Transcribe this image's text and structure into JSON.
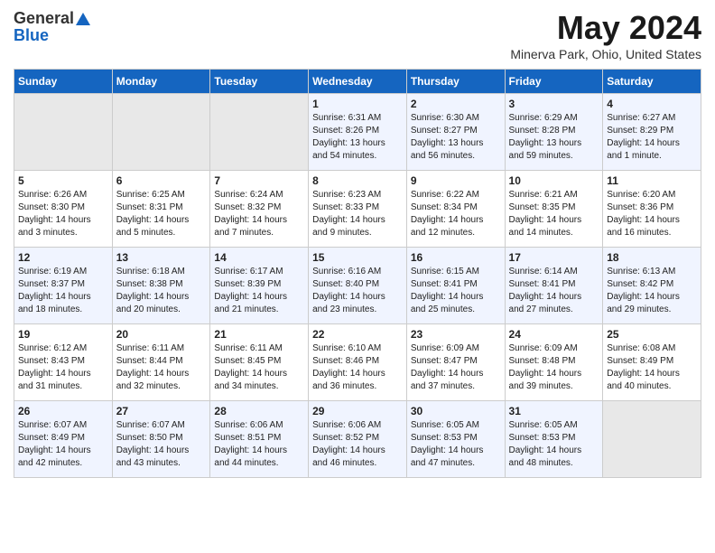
{
  "header": {
    "logo_general": "General",
    "logo_blue": "Blue",
    "title": "May 2024",
    "subtitle": "Minerva Park, Ohio, United States"
  },
  "columns": [
    "Sunday",
    "Monday",
    "Tuesday",
    "Wednesday",
    "Thursday",
    "Friday",
    "Saturday"
  ],
  "weeks": [
    [
      {
        "day": "",
        "empty": true
      },
      {
        "day": "",
        "empty": true
      },
      {
        "day": "",
        "empty": true
      },
      {
        "day": "1",
        "sunrise": "Sunrise: 6:31 AM",
        "sunset": "Sunset: 8:26 PM",
        "daylight": "Daylight: 13 hours and 54 minutes."
      },
      {
        "day": "2",
        "sunrise": "Sunrise: 6:30 AM",
        "sunset": "Sunset: 8:27 PM",
        "daylight": "Daylight: 13 hours and 56 minutes."
      },
      {
        "day": "3",
        "sunrise": "Sunrise: 6:29 AM",
        "sunset": "Sunset: 8:28 PM",
        "daylight": "Daylight: 13 hours and 59 minutes."
      },
      {
        "day": "4",
        "sunrise": "Sunrise: 6:27 AM",
        "sunset": "Sunset: 8:29 PM",
        "daylight": "Daylight: 14 hours and 1 minute."
      }
    ],
    [
      {
        "day": "5",
        "sunrise": "Sunrise: 6:26 AM",
        "sunset": "Sunset: 8:30 PM",
        "daylight": "Daylight: 14 hours and 3 minutes."
      },
      {
        "day": "6",
        "sunrise": "Sunrise: 6:25 AM",
        "sunset": "Sunset: 8:31 PM",
        "daylight": "Daylight: 14 hours and 5 minutes."
      },
      {
        "day": "7",
        "sunrise": "Sunrise: 6:24 AM",
        "sunset": "Sunset: 8:32 PM",
        "daylight": "Daylight: 14 hours and 7 minutes."
      },
      {
        "day": "8",
        "sunrise": "Sunrise: 6:23 AM",
        "sunset": "Sunset: 8:33 PM",
        "daylight": "Daylight: 14 hours and 9 minutes."
      },
      {
        "day": "9",
        "sunrise": "Sunrise: 6:22 AM",
        "sunset": "Sunset: 8:34 PM",
        "daylight": "Daylight: 14 hours and 12 minutes."
      },
      {
        "day": "10",
        "sunrise": "Sunrise: 6:21 AM",
        "sunset": "Sunset: 8:35 PM",
        "daylight": "Daylight: 14 hours and 14 minutes."
      },
      {
        "day": "11",
        "sunrise": "Sunrise: 6:20 AM",
        "sunset": "Sunset: 8:36 PM",
        "daylight": "Daylight: 14 hours and 16 minutes."
      }
    ],
    [
      {
        "day": "12",
        "sunrise": "Sunrise: 6:19 AM",
        "sunset": "Sunset: 8:37 PM",
        "daylight": "Daylight: 14 hours and 18 minutes."
      },
      {
        "day": "13",
        "sunrise": "Sunrise: 6:18 AM",
        "sunset": "Sunset: 8:38 PM",
        "daylight": "Daylight: 14 hours and 20 minutes."
      },
      {
        "day": "14",
        "sunrise": "Sunrise: 6:17 AM",
        "sunset": "Sunset: 8:39 PM",
        "daylight": "Daylight: 14 hours and 21 minutes."
      },
      {
        "day": "15",
        "sunrise": "Sunrise: 6:16 AM",
        "sunset": "Sunset: 8:40 PM",
        "daylight": "Daylight: 14 hours and 23 minutes."
      },
      {
        "day": "16",
        "sunrise": "Sunrise: 6:15 AM",
        "sunset": "Sunset: 8:41 PM",
        "daylight": "Daylight: 14 hours and 25 minutes."
      },
      {
        "day": "17",
        "sunrise": "Sunrise: 6:14 AM",
        "sunset": "Sunset: 8:41 PM",
        "daylight": "Daylight: 14 hours and 27 minutes."
      },
      {
        "day": "18",
        "sunrise": "Sunrise: 6:13 AM",
        "sunset": "Sunset: 8:42 PM",
        "daylight": "Daylight: 14 hours and 29 minutes."
      }
    ],
    [
      {
        "day": "19",
        "sunrise": "Sunrise: 6:12 AM",
        "sunset": "Sunset: 8:43 PM",
        "daylight": "Daylight: 14 hours and 31 minutes."
      },
      {
        "day": "20",
        "sunrise": "Sunrise: 6:11 AM",
        "sunset": "Sunset: 8:44 PM",
        "daylight": "Daylight: 14 hours and 32 minutes."
      },
      {
        "day": "21",
        "sunrise": "Sunrise: 6:11 AM",
        "sunset": "Sunset: 8:45 PM",
        "daylight": "Daylight: 14 hours and 34 minutes."
      },
      {
        "day": "22",
        "sunrise": "Sunrise: 6:10 AM",
        "sunset": "Sunset: 8:46 PM",
        "daylight": "Daylight: 14 hours and 36 minutes."
      },
      {
        "day": "23",
        "sunrise": "Sunrise: 6:09 AM",
        "sunset": "Sunset: 8:47 PM",
        "daylight": "Daylight: 14 hours and 37 minutes."
      },
      {
        "day": "24",
        "sunrise": "Sunrise: 6:09 AM",
        "sunset": "Sunset: 8:48 PM",
        "daylight": "Daylight: 14 hours and 39 minutes."
      },
      {
        "day": "25",
        "sunrise": "Sunrise: 6:08 AM",
        "sunset": "Sunset: 8:49 PM",
        "daylight": "Daylight: 14 hours and 40 minutes."
      }
    ],
    [
      {
        "day": "26",
        "sunrise": "Sunrise: 6:07 AM",
        "sunset": "Sunset: 8:49 PM",
        "daylight": "Daylight: 14 hours and 42 minutes."
      },
      {
        "day": "27",
        "sunrise": "Sunrise: 6:07 AM",
        "sunset": "Sunset: 8:50 PM",
        "daylight": "Daylight: 14 hours and 43 minutes."
      },
      {
        "day": "28",
        "sunrise": "Sunrise: 6:06 AM",
        "sunset": "Sunset: 8:51 PM",
        "daylight": "Daylight: 14 hours and 44 minutes."
      },
      {
        "day": "29",
        "sunrise": "Sunrise: 6:06 AM",
        "sunset": "Sunset: 8:52 PM",
        "daylight": "Daylight: 14 hours and 46 minutes."
      },
      {
        "day": "30",
        "sunrise": "Sunrise: 6:05 AM",
        "sunset": "Sunset: 8:53 PM",
        "daylight": "Daylight: 14 hours and 47 minutes."
      },
      {
        "day": "31",
        "sunrise": "Sunrise: 6:05 AM",
        "sunset": "Sunset: 8:53 PM",
        "daylight": "Daylight: 14 hours and 48 minutes."
      },
      {
        "day": "",
        "empty": true
      }
    ]
  ]
}
